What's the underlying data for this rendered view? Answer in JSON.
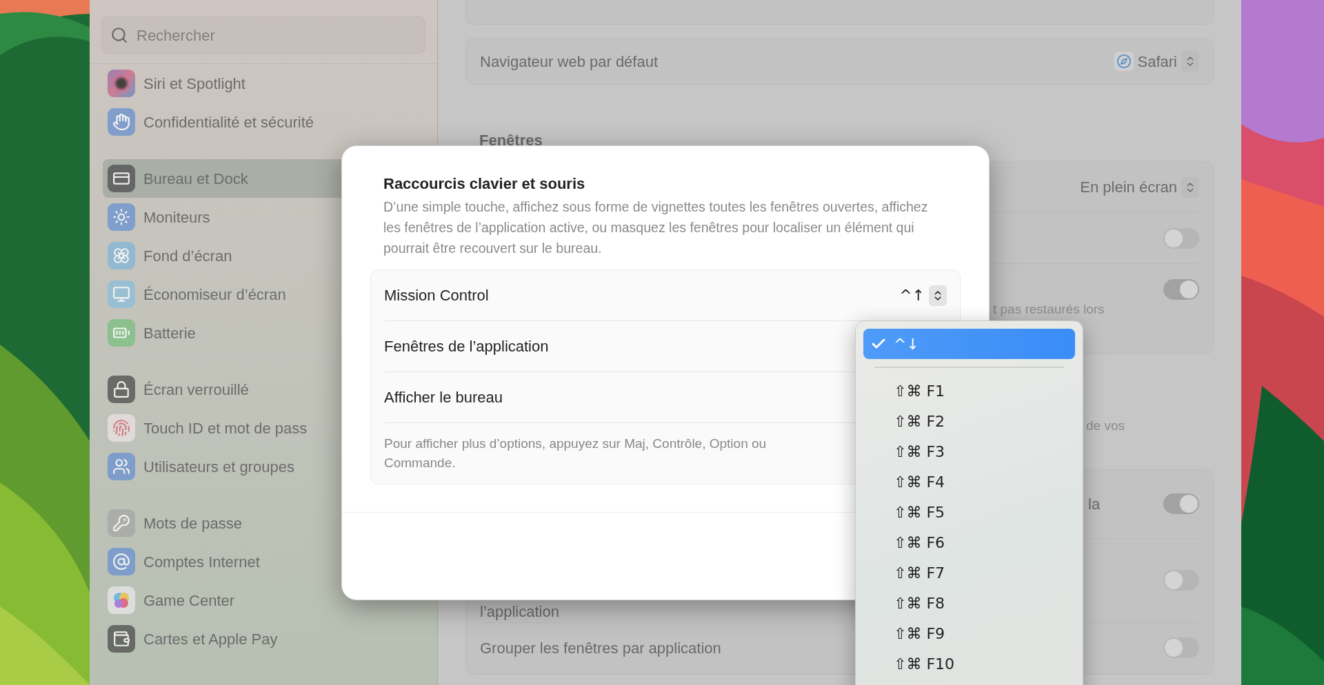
{
  "search": {
    "placeholder": "Rechercher"
  },
  "sidebar": {
    "groups": [
      [
        {
          "label": "Siri et Spotlight",
          "selected": false
        },
        {
          "label": "Confidentialité et sécurité",
          "selected": false
        }
      ],
      [
        {
          "label": "Bureau et Dock",
          "selected": true
        },
        {
          "label": "Moniteurs",
          "selected": false
        },
        {
          "label": "Fond d’écran",
          "selected": false
        },
        {
          "label": "Économiseur d’écran",
          "selected": false
        },
        {
          "label": "Batterie",
          "selected": false
        }
      ],
      [
        {
          "label": "Écran verrouillé",
          "selected": false
        },
        {
          "label": "Touch ID et mot de pass",
          "selected": false
        },
        {
          "label": "Utilisateurs et groupes",
          "selected": false
        }
      ],
      [
        {
          "label": "Mots de passe",
          "selected": false
        },
        {
          "label": "Comptes Internet",
          "selected": false
        },
        {
          "label": "Game Center",
          "selected": false
        },
        {
          "label": "Cartes et Apple Pay",
          "selected": false
        }
      ]
    ]
  },
  "main": {
    "browser_row": {
      "label": "Navigateur web par défaut",
      "value": "Safari"
    },
    "heading": "Fenêtres",
    "card_1": [
      {
        "kind": "select",
        "value": "En plein écran"
      },
      {
        "kind": "toggle",
        "on": false
      },
      {
        "kind": "toggle",
        "on": true,
        "note": "t pas restaurés lors"
      }
    ],
    "section_note": "de vos",
    "card_2": [
      {
        "kind": "toggle",
        "on": true,
        "label": "la",
        "partial": true
      },
      {
        "kind": "toggle",
        "on": false,
        "label": "l’application",
        "partial": false
      },
      {
        "kind": "toggle",
        "on": false,
        "label": "Grouper les fenêtres par application",
        "partial": false
      }
    ]
  },
  "dialog": {
    "title": "Raccourcis clavier et souris",
    "description": "D’une simple touche, affichez sous forme de vignettes toutes les fenêtres ouvertes, affichez les fenêtres de l’application active, ou masquez les fenêtres pour localiser un élément qui pourrait être recouvert sur le bureau.",
    "shortcuts": [
      {
        "label": "Mission Control",
        "value": "^↑"
      },
      {
        "label": "Fenêtres de l’application"
      },
      {
        "label": "Afficher le bureau"
      }
    ],
    "hint": "Pour afficher plus d’options, appuyez sur Maj, Contrôle, Option ou Commande."
  },
  "menu": {
    "items": [
      {
        "kind": "option",
        "label": "^↓",
        "selected": true
      },
      {
        "kind": "separator"
      },
      {
        "kind": "option",
        "label": "⇧⌘ F1",
        "selected": false
      },
      {
        "kind": "option",
        "label": "⇧⌘ F2",
        "selected": false
      },
      {
        "kind": "option",
        "label": "⇧⌘ F3",
        "selected": false
      },
      {
        "kind": "option",
        "label": "⇧⌘ F4",
        "selected": false
      },
      {
        "kind": "option",
        "label": "⇧⌘ F5",
        "selected": false
      },
      {
        "kind": "option",
        "label": "⇧⌘ F6",
        "selected": false
      },
      {
        "kind": "option",
        "label": "⇧⌘ F7",
        "selected": false
      },
      {
        "kind": "option",
        "label": "⇧⌘ F8",
        "selected": false
      },
      {
        "kind": "option",
        "label": "⇧⌘ F9",
        "selected": false
      },
      {
        "kind": "option",
        "label": "⇧⌘ F10",
        "selected": false
      }
    ]
  }
}
